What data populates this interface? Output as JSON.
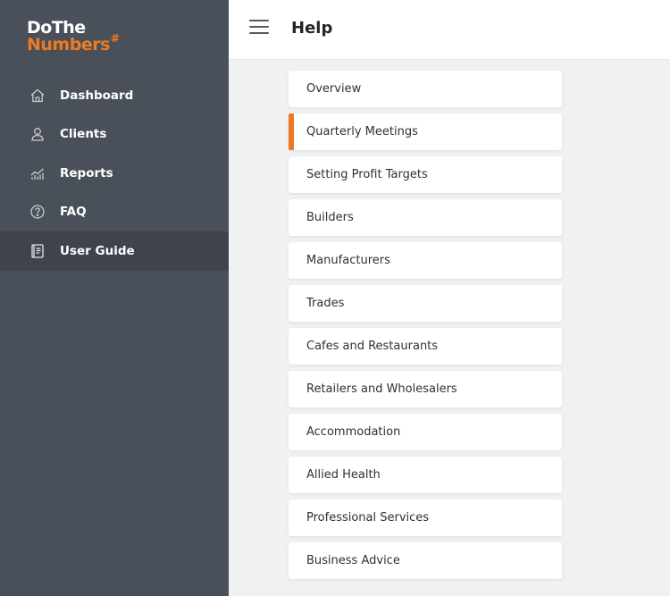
{
  "brand": {
    "line1": "DoThe",
    "line2": "Numbers",
    "hash": "#"
  },
  "sidebar": {
    "items": [
      {
        "label": "Dashboard",
        "icon": "home-icon",
        "active": false
      },
      {
        "label": "Clients",
        "icon": "user-icon",
        "active": false
      },
      {
        "label": "Reports",
        "icon": "chart-icon",
        "active": false
      },
      {
        "label": "FAQ",
        "icon": "question-icon",
        "active": false
      },
      {
        "label": "User Guide",
        "icon": "book-icon",
        "active": true
      }
    ]
  },
  "header": {
    "title": "Help",
    "menu_icon": "hamburger-icon"
  },
  "help": {
    "items": [
      {
        "label": "Overview",
        "active": false
      },
      {
        "label": "Quarterly Meetings",
        "active": true
      },
      {
        "label": "Setting Profit Targets",
        "active": false
      },
      {
        "label": "Builders",
        "active": false
      },
      {
        "label": "Manufacturers",
        "active": false
      },
      {
        "label": "Trades",
        "active": false
      },
      {
        "label": "Cafes and Restaurants",
        "active": false
      },
      {
        "label": "Retailers and Wholesalers",
        "active": false
      },
      {
        "label": "Accommodation",
        "active": false
      },
      {
        "label": "Allied Health",
        "active": false
      },
      {
        "label": "Professional Services",
        "active": false
      },
      {
        "label": "Business Advice",
        "active": false
      }
    ]
  },
  "colors": {
    "sidebar_bg": "#4a5059",
    "sidebar_active_bg": "#3f444c",
    "accent": "#ee7a22",
    "content_bg": "#f0f1f3"
  }
}
